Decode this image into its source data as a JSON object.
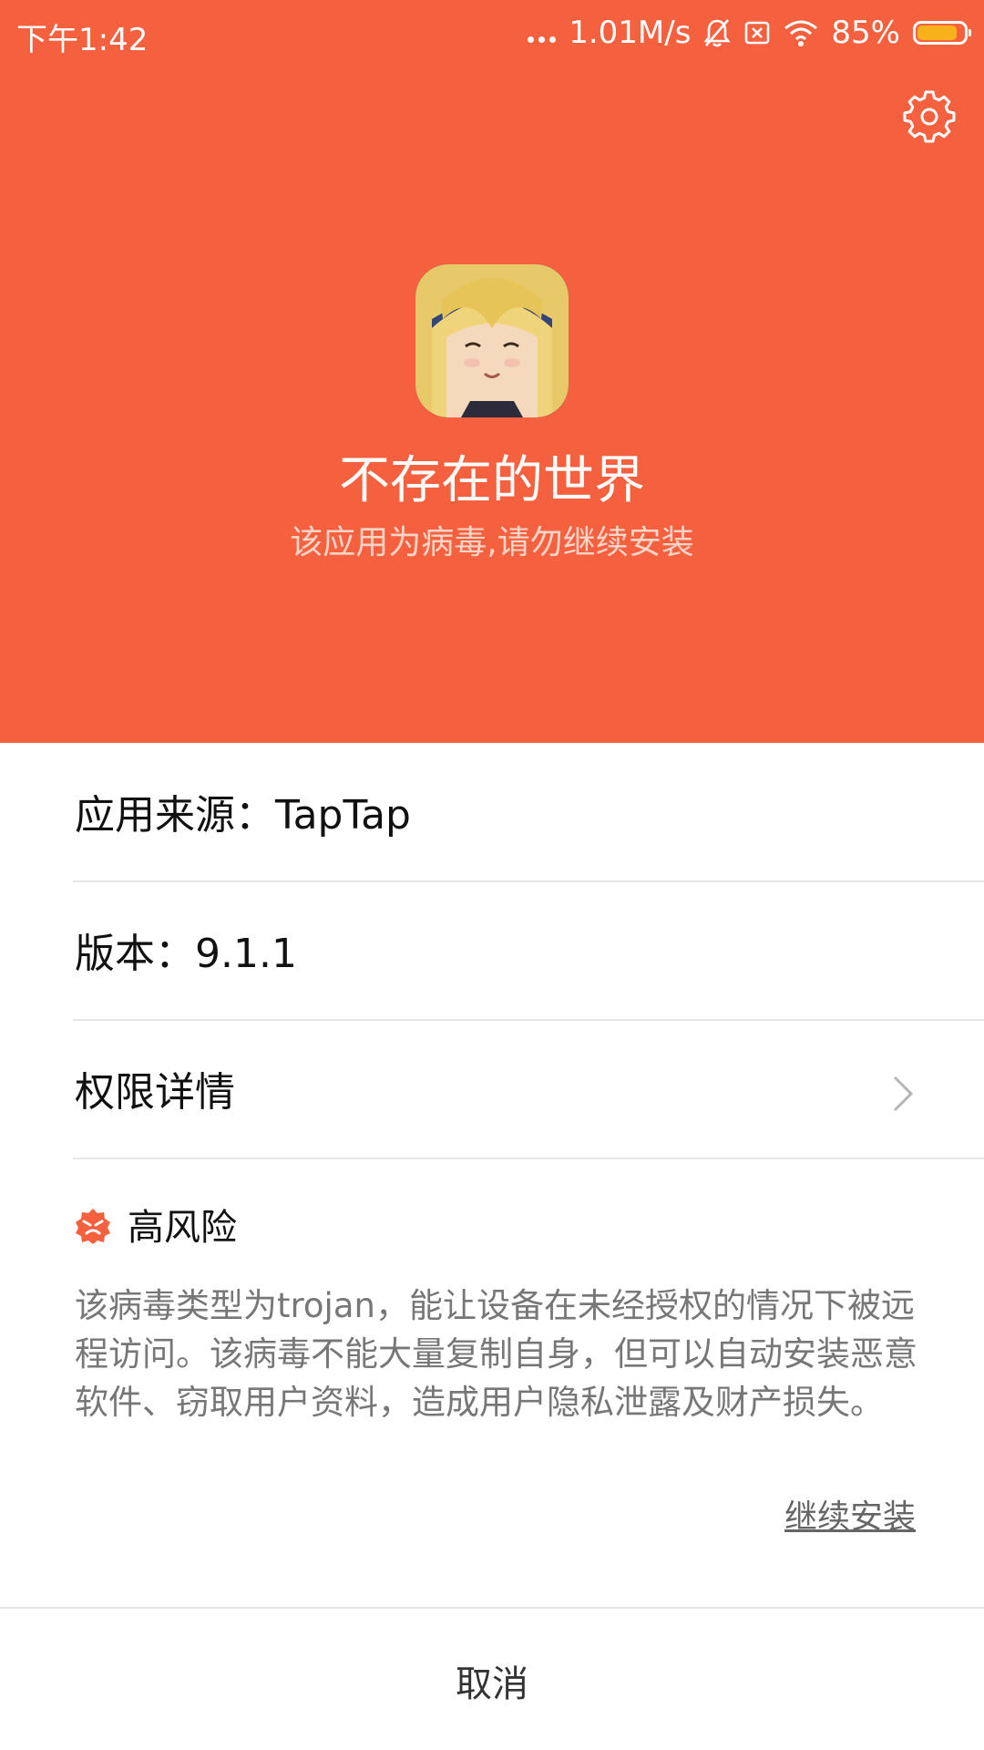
{
  "status_bar": {
    "time": "下午1:42",
    "net_speed": "1.01M/s",
    "battery_percent": "85%",
    "battery_level": 0.85,
    "icons": [
      "more-dots-icon",
      "muted-bell-icon",
      "sim-error-icon",
      "wifi-icon",
      "battery-icon"
    ]
  },
  "header": {
    "background": "#f5613f",
    "settings_icon": "gear-icon",
    "app_name": "不存在的世界",
    "warning": "该应用为病毒,请勿继续安装"
  },
  "info": {
    "source": "应用来源：TapTap",
    "version": "版本：9.1.1",
    "permissions": "权限详情"
  },
  "risk": {
    "icon": "danger-icon",
    "color": "#f5613f",
    "title": "高风险",
    "description": "该病毒类型为trojan，能让设备在未经授权的情况下被远程访问。该病毒不能大量复制自身，但可以自动安装恶意软件、窃取用户资料，造成用户隐私泄露及财产损失。"
  },
  "actions": {
    "continue": "继续安装",
    "cancel": "取消"
  }
}
